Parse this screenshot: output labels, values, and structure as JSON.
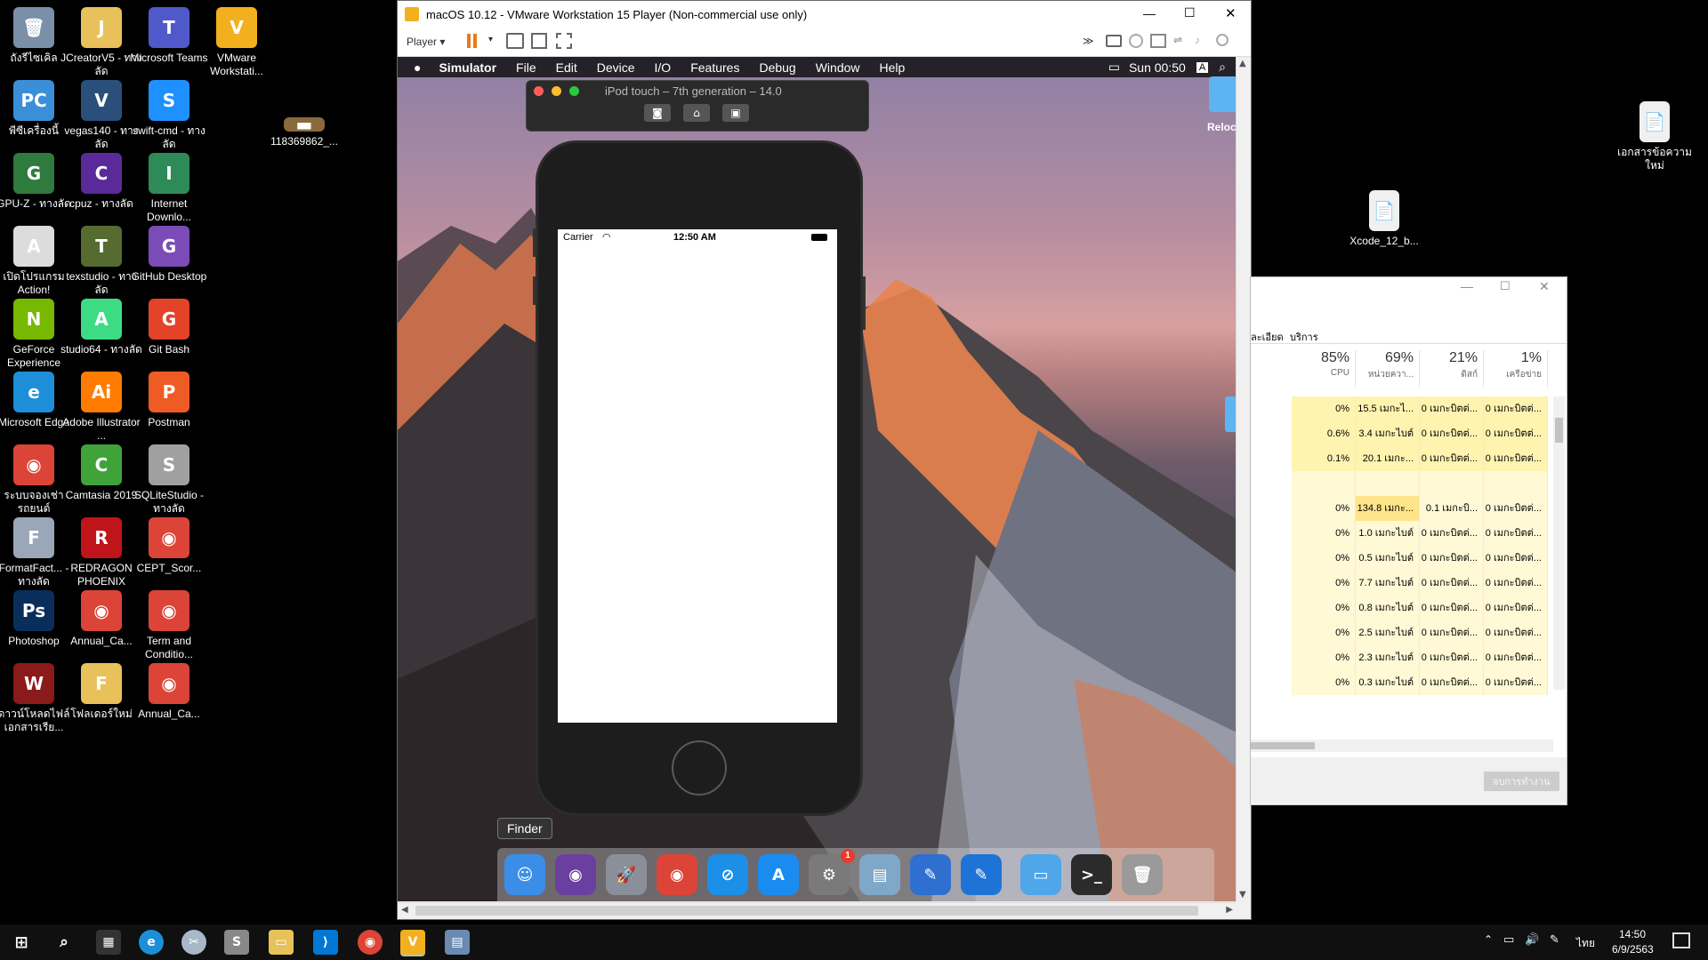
{
  "desktop_icons_left": [
    {
      "label": "ถังรีไซเคิล",
      "color": "#7a8fa8",
      "glyph": "🗑"
    },
    {
      "label": "JCreatorV5 - ทางลัด",
      "color": "#e8c15a",
      "glyph": "J"
    },
    {
      "label": "Microsoft Teams",
      "color": "#5059c9",
      "glyph": "T"
    },
    {
      "label": "VMware Workstati...",
      "color": "#f2b01e",
      "glyph": "V"
    },
    {
      "label": "พีซีเครื่องนี้",
      "color": "#3a8fd8",
      "glyph": "PC"
    },
    {
      "label": "vegas140 - ทางลัด",
      "color": "#2a4f7a",
      "glyph": "V"
    },
    {
      "label": "swift-cmd - ทางลัด",
      "color": "#1e90ff",
      "glyph": "S"
    },
    {
      "label": "GPU-Z - ทางลัด",
      "color": "#2f7a3d",
      "glyph": "G"
    },
    {
      "label": "cpuz - ทางลัด",
      "color": "#5b2a9a",
      "glyph": "C"
    },
    {
      "label": "Internet Downlo...",
      "color": "#2e8b57",
      "glyph": "I"
    },
    {
      "label": "เปิดโปรแกรม Action!",
      "color": "#dcdcdc",
      "glyph": "A"
    },
    {
      "label": "texstudio - ทางลัด",
      "color": "#556b2f",
      "glyph": "T"
    },
    {
      "label": "GitHub Desktop",
      "color": "#7b4bb8",
      "glyph": "G"
    },
    {
      "label": "GeForce Experience",
      "color": "#76b900",
      "glyph": "N"
    },
    {
      "label": "studio64 - ทางลัด",
      "color": "#3ddc84",
      "glyph": "A"
    },
    {
      "label": "Git Bash",
      "color": "#e24329",
      "glyph": "G"
    },
    {
      "label": "Microsoft Edge",
      "color": "#1c8fd8",
      "glyph": "e"
    },
    {
      "label": "Adobe Illustrator ...",
      "color": "#ff7c00",
      "glyph": "Ai"
    },
    {
      "label": "Postman",
      "color": "#ef5b25",
      "glyph": "P"
    },
    {
      "label": "ระบบจองเช่ารถยนต์",
      "color": "#db4437",
      "glyph": "◉"
    },
    {
      "label": "Camtasia 2019",
      "color": "#3fa33a",
      "glyph": "C"
    },
    {
      "label": "SQLiteStudio - ทางลัด",
      "color": "#a0a0a0",
      "glyph": "S"
    },
    {
      "label": "FormatFact... - ทางลัด",
      "color": "#9aa7b8",
      "glyph": "F"
    },
    {
      "label": "REDRAGON PHOENIX",
      "color": "#c0141b",
      "glyph": "R"
    },
    {
      "label": "CEPT_Scor...",
      "color": "#db4437",
      "glyph": "◉"
    },
    {
      "label": "Photoshop",
      "color": "#0a2e5c",
      "glyph": "Ps"
    },
    {
      "label": "Annual_Ca...",
      "color": "#db4437",
      "glyph": "◉"
    },
    {
      "label": "Term and Conditio...",
      "color": "#db4437",
      "glyph": "◉"
    },
    {
      "label": "ดาวน์โหลดไฟล์เอกสารเรีย...",
      "color": "#8b1a1a",
      "glyph": "W"
    },
    {
      "label": "โฟลเดอร์ใหม่",
      "color": "#e8c15a",
      "glyph": "F"
    },
    {
      "label": "Annual_Ca...",
      "color": "#db4437",
      "glyph": "◉"
    }
  ],
  "desktop_icons_other": [
    {
      "label": "118369862_...",
      "color": "#8a6a3a",
      "glyph": "▬"
    },
    {
      "label": "เอกสารข้อความใหม่",
      "color": "#f0f0f0",
      "glyph": "📄"
    },
    {
      "label": "Xcode_12_b...",
      "color": "#f0f0f0",
      "glyph": "📄"
    }
  ],
  "vmware": {
    "title": "macOS 10.12 - VMware Workstation 15 Player (Non-commercial use only)",
    "player_label": "Player",
    "minimize": "—",
    "maximize": "☐",
    "close": "✕"
  },
  "mac_menu": {
    "items": [
      "Simulator",
      "File",
      "Edit",
      "Device",
      "I/O",
      "Features",
      "Debug",
      "Window",
      "Help"
    ],
    "clock": "Sun 00:50",
    "input_badge": "A"
  },
  "simulator": {
    "title": "iPod touch – 7th generation – 14.0",
    "status_carrier": "Carrier",
    "status_time": "12:50 AM"
  },
  "relocate_label": "Reloc",
  "dock": {
    "tooltip": "Finder",
    "items": [
      {
        "name": "finder",
        "color": "#3b8ee8",
        "glyph": "☺"
      },
      {
        "name": "siri",
        "color": "#6b3fa0",
        "glyph": "◉"
      },
      {
        "name": "launchpad",
        "color": "#8a8f99",
        "glyph": "🚀"
      },
      {
        "name": "chrome",
        "color": "#db4437",
        "glyph": "◉"
      },
      {
        "name": "safari",
        "color": "#1c8fe8",
        "glyph": "⊘"
      },
      {
        "name": "app-store",
        "color": "#1a8cf0",
        "glyph": "A"
      },
      {
        "name": "system-preferences",
        "color": "#7a7a7a",
        "glyph": "⚙",
        "badge": "1"
      },
      {
        "name": "preview",
        "color": "#7fa8c8",
        "glyph": "▤"
      },
      {
        "name": "xcode-beta",
        "color": "#2e6fcf",
        "glyph": "✎"
      },
      {
        "name": "xcode",
        "color": "#1e74d6",
        "glyph": "✎"
      },
      {
        "name": "folder",
        "color": "#4fa6e8",
        "glyph": "▭"
      },
      {
        "name": "terminal",
        "color": "#2b2b2b",
        "glyph": ">_"
      },
      {
        "name": "trash",
        "color": "#9a9a9a",
        "glyph": "🗑"
      }
    ]
  },
  "task_manager": {
    "tabs": [
      "ละเอียด",
      "บริการ"
    ],
    "columns": [
      {
        "percent": "85%",
        "label": "CPU"
      },
      {
        "percent": "69%",
        "label": "หน่วยควา..."
      },
      {
        "percent": "21%",
        "label": "ดิสก์"
      },
      {
        "percent": "1%",
        "label": "เครือข่าย"
      }
    ],
    "rows": [
      [
        "0%",
        "15.5 เมกะไ...",
        "0 เมกะบิตต่...",
        "0 เมกะบิตต่..."
      ],
      [
        "0.6%",
        "3.4 เมกะไบต์",
        "0 เมกะบิตต่...",
        "0 เมกะบิตต่..."
      ],
      [
        "0.1%",
        "20.1 เมกะ...",
        "0 เมกะบิตต่...",
        "0 เมกะบิตต่..."
      ],
      [
        "",
        "",
        "",
        ""
      ],
      [
        "0%",
        "134.8 เมกะ...",
        "0.1 เมกะบิ...",
        "0 เมกะบิตต่..."
      ],
      [
        "0%",
        "1.0 เมกะไบต์",
        "0 เมกะบิตต่...",
        "0 เมกะบิตต่..."
      ],
      [
        "0%",
        "0.5 เมกะไบต์",
        "0 เมกะบิตต่...",
        "0 เมกะบิตต่..."
      ],
      [
        "0%",
        "7.7 เมกะไบต์",
        "0 เมกะบิตต่...",
        "0 เมกะบิตต่..."
      ],
      [
        "0%",
        "0.8 เมกะไบต์",
        "0 เมกะบิตต่...",
        "0 เมกะบิตต่..."
      ],
      [
        "0%",
        "2.5 เมกะไบต์",
        "0 เมกะบิตต่...",
        "0 เมกะบิตต่..."
      ],
      [
        "0%",
        "2.3 เมกะไบต์",
        "0 เมกะบิตต่...",
        "0 เมกะบิตต่..."
      ],
      [
        "0%",
        "0.3 เมกะไบต์",
        "0 เมกะบิตต่...",
        "0 เมกะบิตต่..."
      ]
    ],
    "end_task_label": "จบการทำงาน"
  },
  "taskbar": {
    "language": "ไทย",
    "time": "14:50",
    "date": "6/9/2563"
  }
}
